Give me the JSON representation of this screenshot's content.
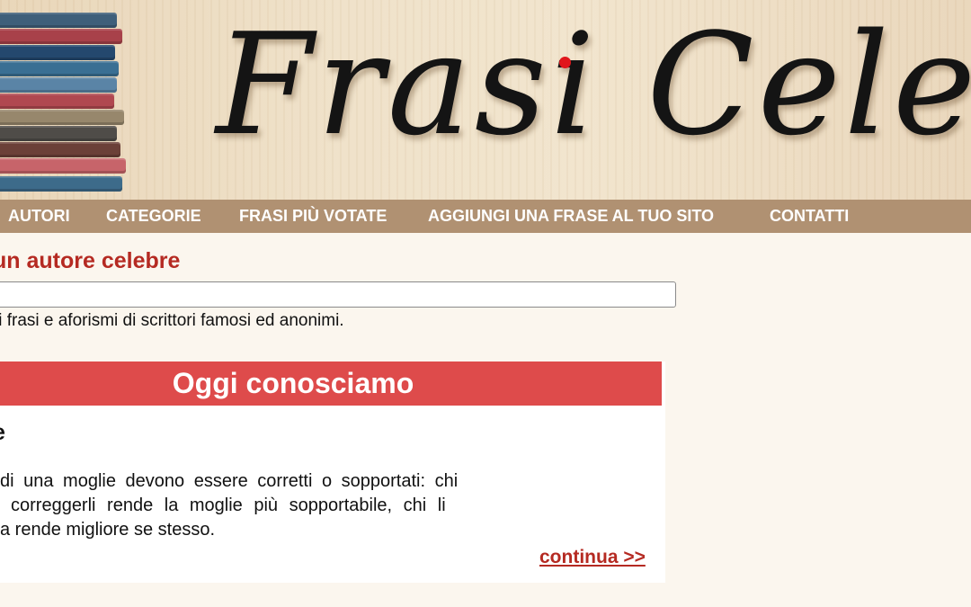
{
  "header": {
    "logo_text": "Frasi Celebri"
  },
  "nav": {
    "items": [
      {
        "label": "AUTORI"
      },
      {
        "label": "CATEGORIE"
      },
      {
        "label": "FRASI PIÙ VOTATE"
      },
      {
        "label": "AGGIUNGI UNA FRASE AL TUO SITO"
      },
      {
        "label": "CONTATTI"
      }
    ]
  },
  "search": {
    "title": "un autore celebre",
    "value": "",
    "subtitle": "li frasi e aforismi di scrittori famosi ed anonimi."
  },
  "daily": {
    "heading": "Oggi conosciamo",
    "author": "e",
    "quote_lines": [
      "di una moglie devono essere corretti o sopportati: chi",
      " correggerli rende la moglie più sopportabile, chi li",
      "a rende migliore se stesso."
    ],
    "more_label": "continua >>"
  },
  "colors": {
    "nav_bg": "#b09172",
    "accent_red": "#b52a22",
    "card_header_bg": "#de4b4b",
    "page_bg": "#fbf6ee"
  }
}
